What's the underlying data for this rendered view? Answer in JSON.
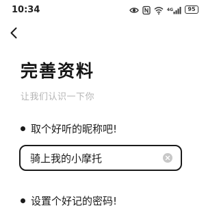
{
  "status_bar": {
    "time": "10:34",
    "network": "4G",
    "battery": "95",
    "icons": [
      "eye-icon",
      "nfc-icon",
      "wifi-icon",
      "signal-icon",
      "battery-icon"
    ]
  },
  "header": {
    "back_icon": "chevron-left-icon"
  },
  "page": {
    "title": "完善资料",
    "subtitle": "让我们认识一下你"
  },
  "nickname": {
    "label": "取个好听的昵称吧!",
    "value": "骑上我的小摩托",
    "clear_icon": "clear-icon"
  },
  "password": {
    "label": "设置个好记的密码!"
  },
  "colors": {
    "text": "#1a1a1a",
    "subtitle": "#b4b4b4",
    "clear_icon_bg": "#c8c8c8",
    "background": "#ffffff"
  }
}
